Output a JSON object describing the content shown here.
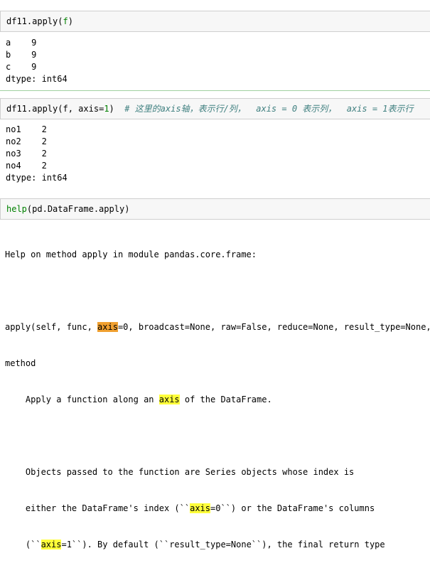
{
  "cells": [
    {
      "input": {
        "fn": "df11.apply",
        "arg": "f"
      },
      "output": [
        "a    9",
        "b    9",
        "c    9",
        "dtype: int64"
      ]
    },
    {
      "input": {
        "fn": "df11.apply",
        "arg_f": "f",
        "arg_axis_kw": "axis",
        "arg_axis_val": "1",
        "comment": "# 这里的axis轴，表示行/列，  axis = 0 表示列，  axis = 1表示行"
      },
      "output": [
        "no1    2",
        "no2    2",
        "no3    2",
        "no4    2",
        "dtype: int64"
      ]
    },
    {
      "input": {
        "fn": "help",
        "arg": "pd.DataFrame.apply"
      },
      "output_help": {
        "line1": "Help on method apply in module pandas.core.frame:",
        "sig_pre": "apply(self, func, ",
        "sig_axis": "axis",
        "sig_post": "=0, broadcast=None, raw=False, reduce=None, result_type=None, ar",
        "line_method": "method",
        "desc_pre": "    Apply a function along an ",
        "desc_axis": "axis",
        "desc_post": " of the DataFrame.",
        "p2_line1": "    Objects passed to the function are Series objects whose index is",
        "p2_line2_pre": "    either the DataFrame's index (``",
        "p2_line2_axis": "axis",
        "p2_line2_mid": "=0``) or the DataFrame's columns",
        "p2_line3_pre": "    (``",
        "p2_line3_axis": "axis",
        "p2_line3_post": "=1``). By default (``result_type=None``), the final return type"
      }
    }
  ]
}
